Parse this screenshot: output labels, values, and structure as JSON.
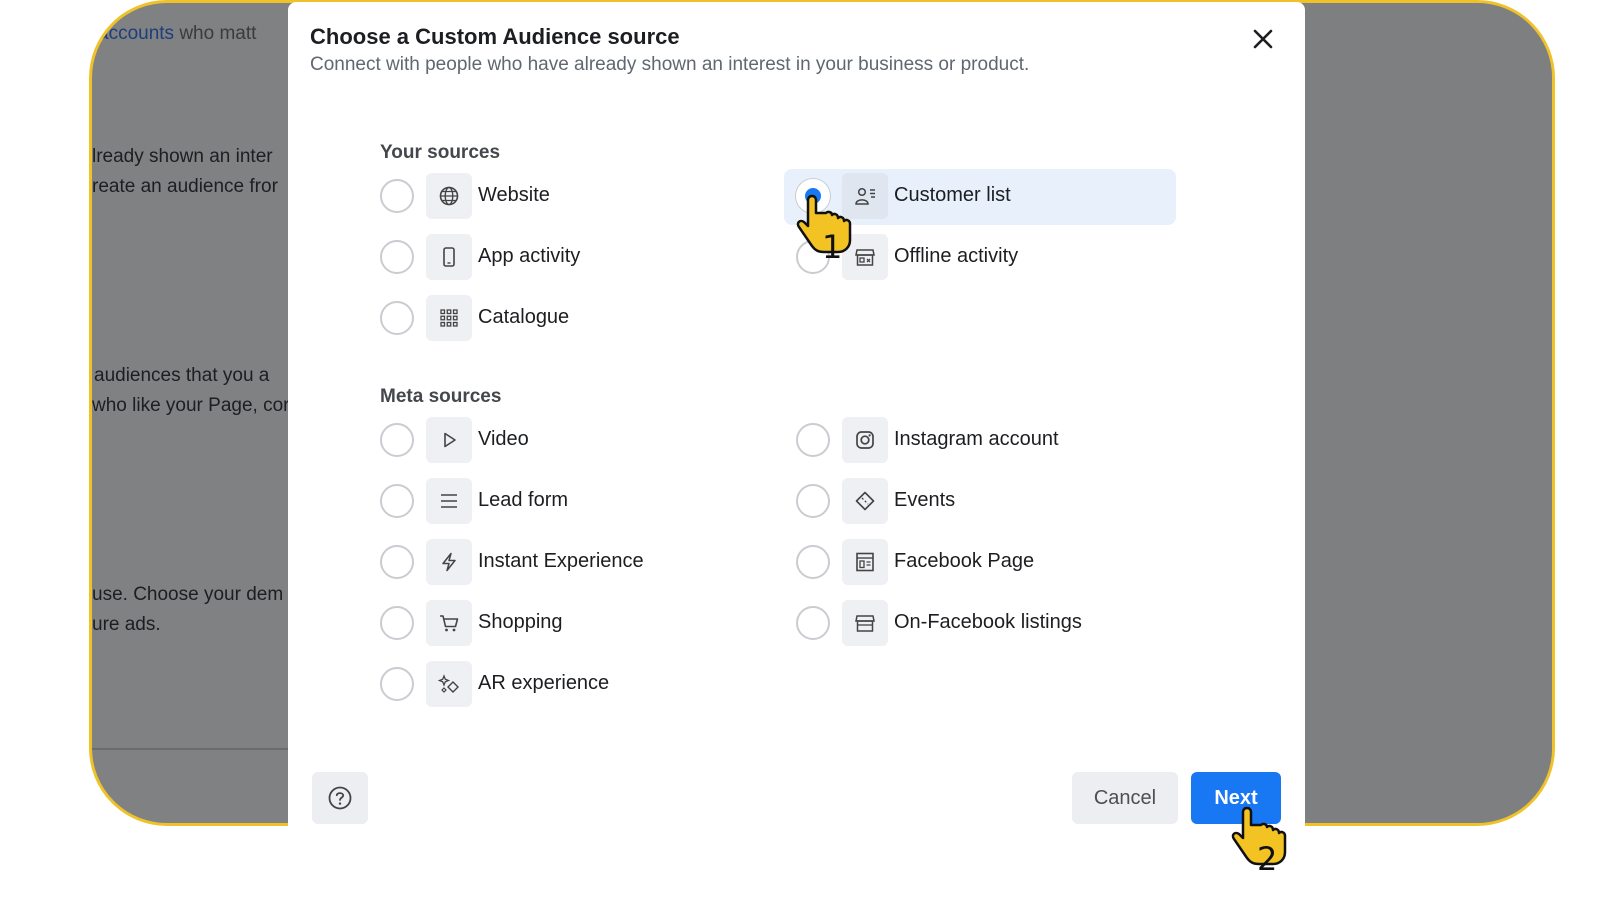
{
  "background": {
    "fragments": [
      "accounts",
      "who matt",
      "lready shown an inter",
      "reate an audience fror",
      "audiences that you a",
      "who like your Page, cor",
      "use. Choose your dem",
      "ure ads."
    ]
  },
  "modal": {
    "title": "Choose a Custom Audience source",
    "subtitle": "Connect with people who have already shown an interest in your business or product.",
    "your_sources": {
      "heading": "Your sources",
      "options": [
        {
          "label": "Website",
          "icon": "globe-icon",
          "selected": false
        },
        {
          "label": "Customer list",
          "icon": "customer-list-icon",
          "selected": true
        },
        {
          "label": "App activity",
          "icon": "phone-icon",
          "selected": false
        },
        {
          "label": "Offline activity",
          "icon": "store-icon",
          "selected": false
        },
        {
          "label": "Catalogue",
          "icon": "grid-icon",
          "selected": false
        }
      ]
    },
    "meta_sources": {
      "heading": "Meta sources",
      "options": [
        {
          "label": "Video",
          "icon": "play-icon"
        },
        {
          "label": "Instagram account",
          "icon": "instagram-icon"
        },
        {
          "label": "Lead form",
          "icon": "lines-icon"
        },
        {
          "label": "Events",
          "icon": "ticket-icon"
        },
        {
          "label": "Instant Experience",
          "icon": "lightning-icon"
        },
        {
          "label": "Facebook Page",
          "icon": "page-icon"
        },
        {
          "label": "Shopping",
          "icon": "cart-icon"
        },
        {
          "label": "On-Facebook listings",
          "icon": "storefront-icon"
        },
        {
          "label": "AR experience",
          "icon": "sparkle-icon"
        }
      ]
    },
    "buttons": {
      "cancel": "Cancel",
      "next": "Next"
    }
  },
  "annotations": {
    "step1": "1",
    "step2": "2"
  },
  "colors": {
    "accent": "#1877f2",
    "frame": "#f0c22a",
    "selected_bg": "#e7f0fb"
  }
}
